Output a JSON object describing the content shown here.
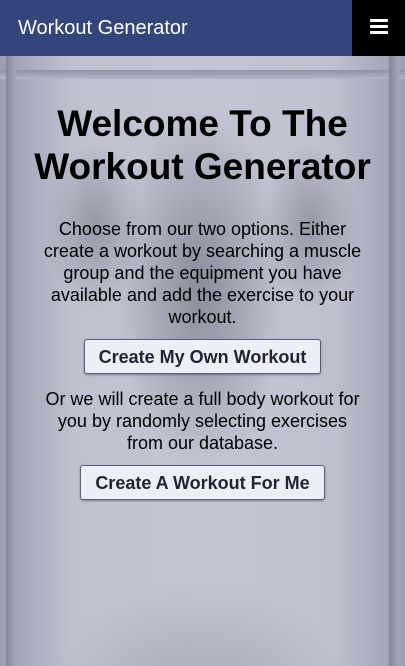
{
  "navbar": {
    "brand": "Workout Generator",
    "menu_icon": "hamburger-menu-icon"
  },
  "main": {
    "title": "Welcome To The Workout Generator",
    "intro": "Choose from our two options. Either create a workout by searching a muscle group and the equipment you have available and add the exercise to your workout.",
    "create_own_label": "Create My Own Workout",
    "random_text": "Or we will create a full body workout for you by randomly selecting exercises from our database.",
    "create_random_label": "Create A Workout For Me"
  },
  "colors": {
    "navbar": "#33457a",
    "menu_button": "#000000",
    "button_bg": "#eceef8"
  }
}
